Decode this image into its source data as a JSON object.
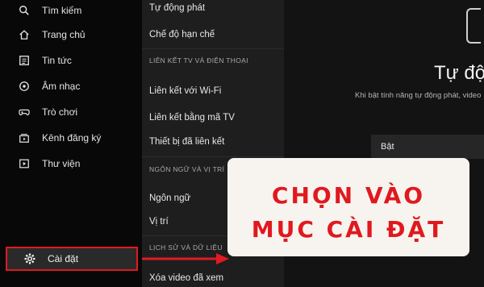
{
  "sidebar": {
    "items": [
      {
        "label": "Tìm kiếm",
        "icon": "search-icon"
      },
      {
        "label": "Trang chủ",
        "icon": "home-icon"
      },
      {
        "label": "Tin tức",
        "icon": "news-icon"
      },
      {
        "label": "Âm nhạc",
        "icon": "music-icon"
      },
      {
        "label": "Trò chơi",
        "icon": "game-icon"
      },
      {
        "label": "Kênh đăng ký",
        "icon": "subscriptions-icon"
      },
      {
        "label": "Thư viện",
        "icon": "library-icon"
      }
    ],
    "settings": {
      "label": "Cài đặt",
      "icon": "gear-icon"
    }
  },
  "menu": {
    "items": [
      {
        "kind": "item",
        "label": "Tự động phát"
      },
      {
        "kind": "item",
        "label": "Chế độ hạn chế"
      },
      {
        "kind": "heading",
        "label": "LIÊN KẾT TV VÀ ĐIỆN THOẠI"
      },
      {
        "kind": "item",
        "label": "Liên kết với Wi-Fi"
      },
      {
        "kind": "item",
        "label": "Liên kết bằng mã TV"
      },
      {
        "kind": "item",
        "label": "Thiết bị đã liên kết"
      },
      {
        "kind": "heading",
        "label": "NGÔN NGỮ VÀ VỊ TRÍ"
      },
      {
        "kind": "item",
        "label": "Ngôn ngữ"
      },
      {
        "kind": "item",
        "label": "Vị trí"
      },
      {
        "kind": "heading",
        "label": "LỊCH SỬ VÀ DỮ LIỆU"
      },
      {
        "kind": "item",
        "label": "Xóa video đã xem"
      }
    ]
  },
  "detail": {
    "title": "Tự độ",
    "subtitle": "Khi bật tính năng tự động phát, video",
    "option": "Bật"
  },
  "callout": {
    "line1": "CHỌN VÀO",
    "line2": "MỤC CÀI ĐẶT"
  },
  "colors": {
    "highlight": "#e01a22",
    "callout_bg": "#f7f4ef"
  }
}
